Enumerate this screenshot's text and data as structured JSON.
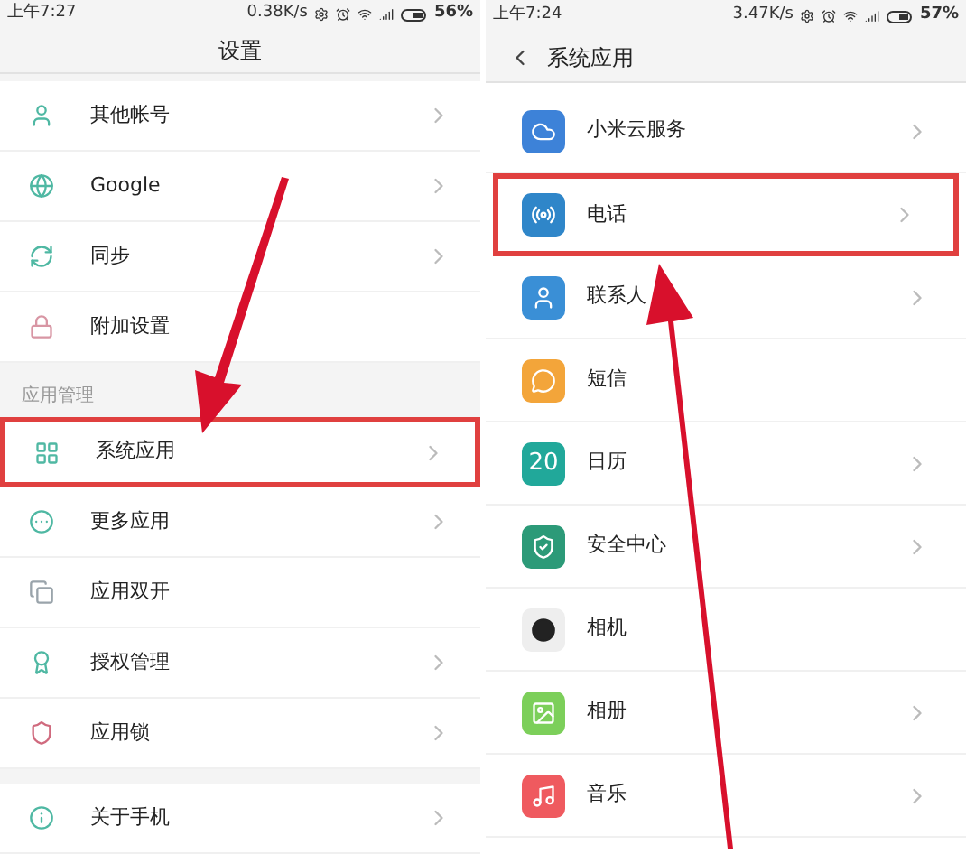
{
  "left_screen": {
    "status_bar": {
      "time": "上午7:27",
      "speed": "0.38K/s",
      "battery": "56%"
    },
    "title": "设置",
    "groups": [
      {
        "items": [
          {
            "label": "其他帐号",
            "chevron": true,
            "highlighted": false
          },
          {
            "label": "Google",
            "chevron": true,
            "highlighted": false
          },
          {
            "label": "同步",
            "chevron": true,
            "highlighted": false
          },
          {
            "label": "附加设置",
            "chevron": false,
            "highlighted": false
          }
        ]
      },
      {
        "label": "应用管理",
        "items": [
          {
            "label": "系统应用",
            "chevron": true,
            "highlighted": true
          },
          {
            "label": "更多应用",
            "chevron": true,
            "highlighted": false
          },
          {
            "label": "应用双开",
            "chevron": false,
            "highlighted": false
          },
          {
            "label": "授权管理",
            "chevron": true,
            "highlighted": false
          },
          {
            "label": "应用锁",
            "chevron": true,
            "highlighted": false
          }
        ]
      },
      {
        "items": [
          {
            "label": "关于手机",
            "chevron": true,
            "highlighted": false
          }
        ]
      }
    ]
  },
  "right_screen": {
    "status_bar": {
      "time": "上午7:24",
      "speed": "3.47K/s",
      "battery": "57%"
    },
    "title": "系统应用",
    "items": [
      {
        "label": "小米云服务",
        "color": "#3d82d8",
        "chevron": true,
        "highlighted": false
      },
      {
        "label": "电话",
        "color": "#2f86c9",
        "chevron": true,
        "highlighted": true
      },
      {
        "label": "联系人",
        "color": "#3a8fd6",
        "chevron": true,
        "highlighted": false
      },
      {
        "label": "短信",
        "color": "#f3a53a",
        "chevron": false,
        "highlighted": false
      },
      {
        "label": "日历",
        "color": "#21a89a",
        "icon_text": "20",
        "chevron": true,
        "highlighted": false
      },
      {
        "label": "安全中心",
        "color": "#2c9a78",
        "chevron": true,
        "highlighted": false
      },
      {
        "label": "相机",
        "color": "#eeeeee",
        "chevron": false,
        "highlighted": false
      },
      {
        "label": "相册",
        "color": "#7ccf5a",
        "chevron": true,
        "highlighted": false
      },
      {
        "label": "音乐",
        "color": "#ef5a5f",
        "chevron": true,
        "highlighted": false
      }
    ]
  }
}
